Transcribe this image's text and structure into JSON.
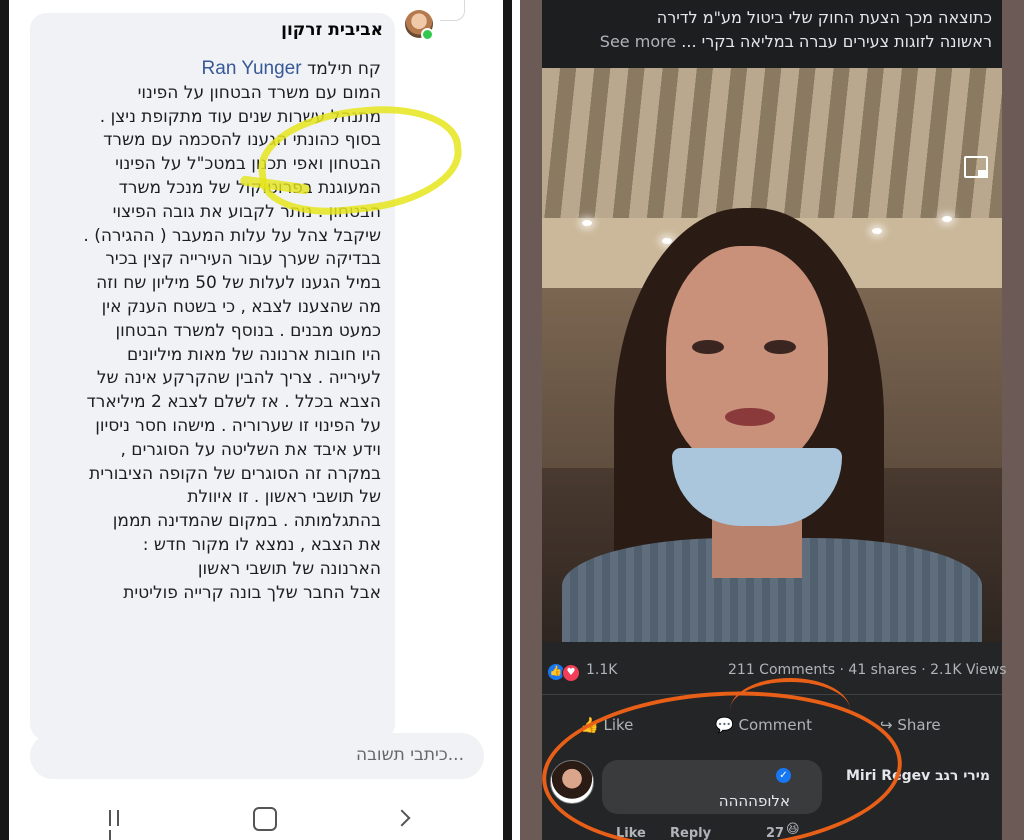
{
  "left": {
    "author": "אביבית זרקון",
    "mention": "Ran Yunger",
    "lines": [
      "קח תילמד ",
      "המום עם משרד הבטחון על הפינוי",
      "מתנהל עשרות שנים עוד מתקופת ניצן .",
      "בסוף כהונתי הגענו להסכמה עם משרד",
      "הבטחון ואפי תכנון במטכ\"ל על הפינוי",
      "המעוגנת בפרוטוקול של מנכל משרד",
      "הבטחון . נותר לקבוע את גובה הפיצוי",
      "שיקבל צהל על עלות המעבר ( ההגירה) .",
      "בבדיקה שערך עבור העירייה קצין בכיר",
      "במיל הגענו לעלות של 50 מיליון שח וזה",
      "מה שהצענו לצבא , כי בשטח הענק אין",
      "כמעט מבנים . בנוסף למשרד הבטחון",
      "היו חובות ארנונה של מאות מיליונים",
      "לעירייה . צריך להבין שהקרקע אינה של",
      "הצבא בכלל . אז לשלם לצבא 2 מיליארד",
      "על הפינוי זו שערוריה . מישהו חסר ניסיון",
      "וידע איבד את השליטה על הסוגרים ,",
      "במקרה זה הסוגרים של הקופה הציבורית",
      "של תושבי ראשון . זו איוולת",
      "בהתגלמותה . במקום שהמדינה תממן",
      "את הצבא , נמצא לו מקור חדש :",
      "הארנונה של תושבי ראשון",
      "אבל החבר שלך בונה קרייה פוליטית"
    ],
    "reply_placeholder": "...כיתבי תשובה"
  },
  "right": {
    "caption_line1": "כתוצאה מכך הצעת החוק שלי ביטול מע\"מ לדירה",
    "caption_line2": "ראשונה לזוגות צעירים עברה במליאה בקרי ...",
    "see_more": "See more",
    "reactions_count": "1.1K",
    "stats": "211 Comments · 41 shares · 2.1K Views",
    "like": "Like",
    "comment": "Comment",
    "share": "Share",
    "commenter_name": "Miri Regev מירי רגב",
    "comment_text": "אלופהההה",
    "footer_like": "Like",
    "footer_reply": "Reply",
    "footer_count": "27"
  },
  "colors": {
    "highlight": "#e5e51c",
    "annotation": "#e85f18",
    "link": "#385898",
    "fb_blue": "#1877f2"
  },
  "icons": [
    "online-status-dot",
    "like-reaction-icon",
    "love-reaction-icon",
    "picture-in-picture-icon",
    "volume-icon",
    "thumbs-up-icon",
    "comment-icon",
    "share-icon",
    "verified-badge-icon",
    "laugh-reaction-icon",
    "recents-nav-icon",
    "home-nav-icon",
    "back-nav-icon"
  ]
}
